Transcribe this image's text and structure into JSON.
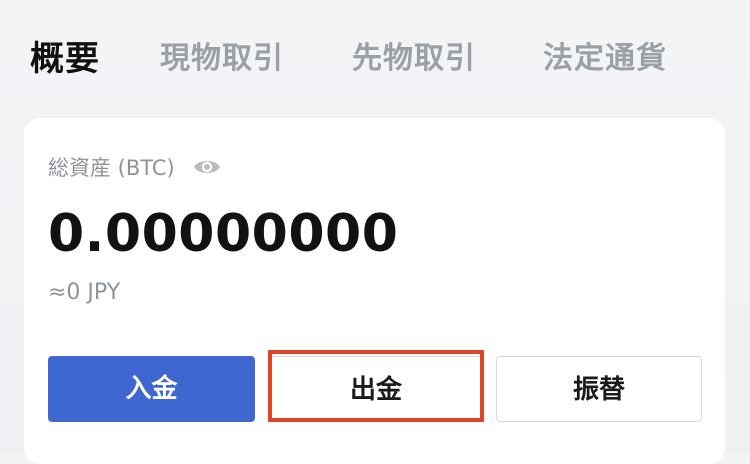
{
  "tabs": [
    {
      "label": "概要",
      "active": true
    },
    {
      "label": "現物取引",
      "active": false
    },
    {
      "label": "先物取引",
      "active": false
    },
    {
      "label": "法定通貨",
      "active": false
    }
  ],
  "assets": {
    "label": "総資産 (BTC)",
    "visibility_icon": "eye-icon",
    "balance": "0.00000000",
    "fiat_equivalent": "≈0 JPY"
  },
  "actions": {
    "deposit_label": "入金",
    "withdraw_label": "出金",
    "transfer_label": "振替"
  },
  "colors": {
    "primary_button": "#3e67d2",
    "highlight_border": "#e0452b",
    "active_tab": "#111111",
    "inactive_tab": "#9aa0a6"
  }
}
